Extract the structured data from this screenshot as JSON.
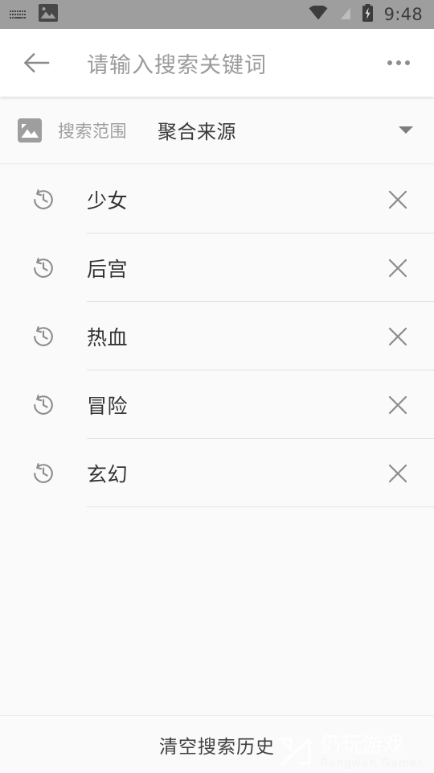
{
  "status_bar": {
    "icons_left": [
      "keyboard-icon",
      "image-icon"
    ],
    "icons_right": [
      "wifi-icon",
      "signal-off-icon",
      "battery-charging-icon"
    ],
    "time": "9:48",
    "background_color": "#9e9e9e"
  },
  "app_bar": {
    "back_icon": "arrow-left-icon",
    "search_placeholder": "请输入搜索关键词",
    "overflow_icon": "more-horizontal-icon"
  },
  "scope_row": {
    "icon": "image-icon",
    "label": "搜索范围",
    "value": "聚合来源",
    "caret_icon": "chevron-down-icon"
  },
  "history": {
    "items": [
      {
        "text": "少女",
        "icon": "history-icon",
        "delete_icon": "close-icon"
      },
      {
        "text": "后宫",
        "icon": "history-icon",
        "delete_icon": "close-icon"
      },
      {
        "text": "热血",
        "icon": "history-icon",
        "delete_icon": "close-icon"
      },
      {
        "text": "冒险",
        "icon": "history-icon",
        "delete_icon": "close-icon"
      },
      {
        "text": "玄幻",
        "icon": "history-icon",
        "delete_icon": "close-icon"
      }
    ]
  },
  "bottom_bar": {
    "clear_label": "清空搜索历史"
  },
  "watermark": {
    "cn": "仍玩游戏",
    "en": "Rengwan Games"
  },
  "colors": {
    "page_background": "#fafafa",
    "app_bar_background": "#ffffff",
    "status_bar": "#9e9e9e",
    "primary_text": "#333333",
    "secondary_text": "#9e9e9e",
    "divider": "#e3e3e3"
  }
}
